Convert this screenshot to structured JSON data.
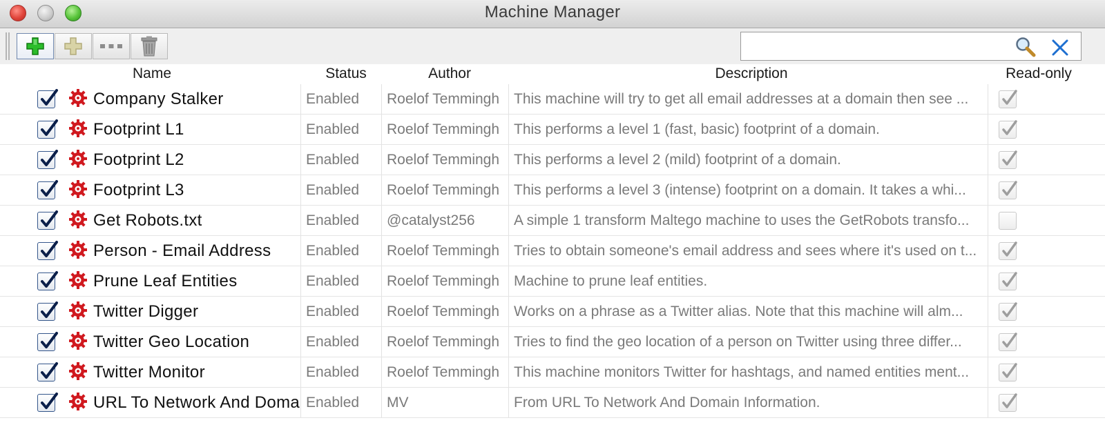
{
  "window": {
    "title": "Machine Manager"
  },
  "toolbar": {
    "buttons": [
      {
        "icon": "add-icon"
      },
      {
        "icon": "add-disabled-icon"
      },
      {
        "icon": "more-icon"
      },
      {
        "icon": "trash-icon"
      }
    ],
    "search": {
      "value": "",
      "placeholder": ""
    }
  },
  "columns": {
    "name": "Name",
    "status": "Status",
    "author": "Author",
    "description": "Description",
    "readonly": "Read-only"
  },
  "colors": {
    "checkbox_border": "#33558a",
    "check_mark": "#0b1f4a",
    "gear_red": "#d0191f",
    "muted_text": "#7a7a7a",
    "add_green": "#1faa1f"
  },
  "rows": [
    {
      "enabled": true,
      "name": "Company Stalker",
      "status": "Enabled",
      "author": "Roelof Temmingh",
      "description": "This machine will try to get all email addresses at a domain then see ...",
      "readonly": true
    },
    {
      "enabled": true,
      "name": "Footprint L1",
      "status": "Enabled",
      "author": "Roelof Temmingh",
      "description": "This performs a level 1 (fast, basic) footprint of a domain.",
      "readonly": true
    },
    {
      "enabled": true,
      "name": "Footprint L2",
      "status": "Enabled",
      "author": "Roelof Temmingh",
      "description": "This performs a level 2 (mild) footprint of a domain.",
      "readonly": true
    },
    {
      "enabled": true,
      "name": "Footprint L3",
      "status": "Enabled",
      "author": "Roelof Temmingh",
      "description": "This performs a level 3 (intense) footprint on a domain. It takes a whi...",
      "readonly": true
    },
    {
      "enabled": true,
      "name": "Get Robots.txt",
      "status": "Enabled",
      "author": "@catalyst256",
      "description": "A simple 1 transform Maltego machine to uses the GetRobots transfo...",
      "readonly": false
    },
    {
      "enabled": true,
      "name": "Person - Email Address",
      "status": "Enabled",
      "author": "Roelof Temmingh",
      "description": "Tries to obtain someone's email address and sees where it's used on t...",
      "readonly": true
    },
    {
      "enabled": true,
      "name": "Prune Leaf Entities",
      "status": "Enabled",
      "author": "Roelof Temmingh",
      "description": "Machine to prune leaf entities.",
      "readonly": true
    },
    {
      "enabled": true,
      "name": "Twitter Digger",
      "status": "Enabled",
      "author": "Roelof Temmingh",
      "description": "Works on a phrase as a Twitter alias. Note that this machine will alm...",
      "readonly": true
    },
    {
      "enabled": true,
      "name": "Twitter Geo Location",
      "status": "Enabled",
      "author": "Roelof Temmingh",
      "description": "Tries to find the geo location of a person on Twitter using three differ...",
      "readonly": true
    },
    {
      "enabled": true,
      "name": "Twitter Monitor",
      "status": "Enabled",
      "author": "Roelof Temmingh",
      "description": "This machine monitors Twitter for hashtags, and named entities ment...",
      "readonly": true
    },
    {
      "enabled": true,
      "name": "URL To Network And Domain Information",
      "status": "Enabled",
      "author": "MV",
      "description": "From URL To Network And Domain Information.",
      "readonly": true
    }
  ]
}
